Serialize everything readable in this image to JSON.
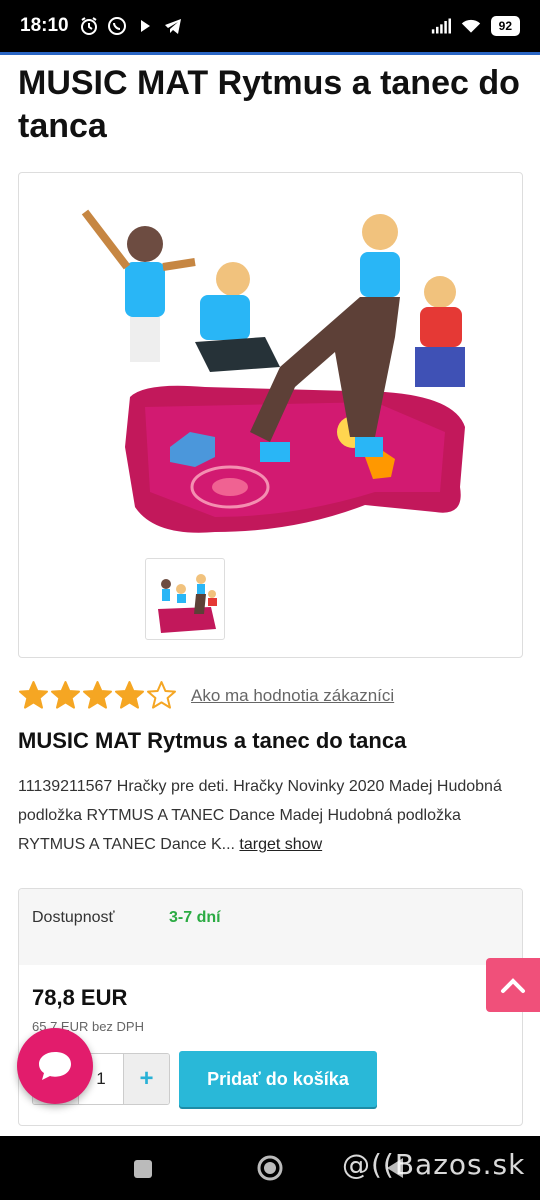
{
  "status": {
    "time": "18:10",
    "battery": "92",
    "icons_left": [
      "alarm-icon",
      "whatsapp-icon",
      "play-icon",
      "telegram-icon"
    ],
    "icons_right": [
      "signal-icon",
      "wifi-icon",
      "battery-icon"
    ]
  },
  "page": {
    "title": "MUSIC MAT Rytmus a tanec do tanca"
  },
  "rating": {
    "stars": 4,
    "max": 5,
    "link_text": "Ako ma hodnotia zákazníci",
    "star_color": "#f5a623"
  },
  "product": {
    "name": "MUSIC MAT Rytmus a tanec do tanca",
    "description": "11139211567 Hračky pre deti. Hračky Novinky 2020 Madej Hudobná podložka RYTMUS A TANEC Dance Madej Hudobná podložka RYTMUS A TANEC Dance K...",
    "show_link": "target show"
  },
  "buy": {
    "availability_label": "Dostupnosť",
    "availability_value": "3-7 dní",
    "price": "78,8 EUR",
    "price_net": "65,7 EUR bez DPH",
    "quantity": "1",
    "minus": "−",
    "plus": "+",
    "add_to_cart": "Pridať do košíka"
  },
  "watermark": "@((Bazos.sk",
  "colors": {
    "accent": "#29b8d8",
    "pink": "#e21c6c",
    "available": "#2bab43"
  }
}
